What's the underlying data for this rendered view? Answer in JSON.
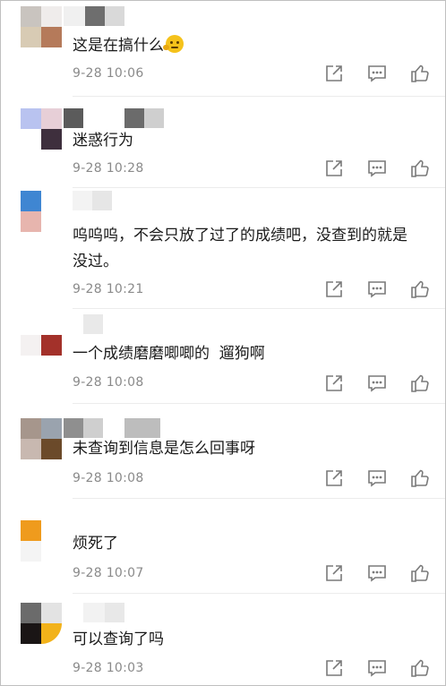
{
  "comments": [
    {
      "text": "这是在搞什么",
      "emoji": "thinking-face",
      "time": "9-28 10:06",
      "avatar_colors": [
        "#c9c4bf",
        "#efeceb",
        "#d8cbb4",
        "#b57a5a"
      ],
      "name_colors": [
        "#f0f0f0",
        "#6e6e6e",
        "#d9d9d9"
      ]
    },
    {
      "text": "迷惑行为",
      "time": "9-28 10:28",
      "avatar_colors": [
        "#b9c3f0",
        "#e7cfd7",
        "#ffffff",
        "#3e2f3d"
      ],
      "name_colors": [
        "#5b5b5b",
        "#6b6b6b",
        "#cfcfcf"
      ]
    },
    {
      "text": "呜呜呜，不会只放了过了的成绩吧，没查到的就是没过。",
      "time": "9-28 10:21",
      "avatar_colors": [
        "#3f86d2",
        "#ffffff",
        "#e7b5ae",
        "#ffffff"
      ],
      "name_colors": [
        "#f3f3f3",
        "#e6e6e6",
        "#ffffff"
      ]
    },
    {
      "text": "一个成绩磨磨唧唧的  遛狗啊",
      "time": "9-28 10:08",
      "avatar_colors": [
        "#ffffff",
        "#ffffff",
        "#f4f1f1",
        "#a3312a"
      ],
      "name_colors": [
        "#e9e9e9",
        "#ffffff",
        "#ffffff"
      ]
    },
    {
      "text": "未查询到信息是怎么回事呀",
      "time": "9-28 10:08",
      "avatar_colors": [
        "#a6968c",
        "#9aa3ae",
        "#c8b8b0",
        "#6b4a2a"
      ],
      "name_colors": [
        "#8f8f8f",
        "#cfcfcf",
        "#bdbdbd"
      ]
    },
    {
      "text": "烦死了",
      "time": "9-28 10:07",
      "avatar_colors": [
        "#ef9b1d",
        "#ffffff",
        "#f4f4f4",
        "#ffffff"
      ],
      "name_colors": [
        "#ffffff",
        "#ffffff",
        "#ffffff"
      ]
    },
    {
      "text": "可以查询了吗",
      "time": "9-28 10:03",
      "avatar_colors": [
        "#6b6b6b",
        "#e3e3e3",
        "#1a1515",
        "#f2b21a"
      ],
      "name_colors": [
        "#f2f2f2",
        "#e8e8e8",
        "#f4f4f4"
      ]
    }
  ],
  "icons": {
    "share": "share-icon",
    "reply": "comment-icon",
    "like": "thumbs-up-icon"
  }
}
